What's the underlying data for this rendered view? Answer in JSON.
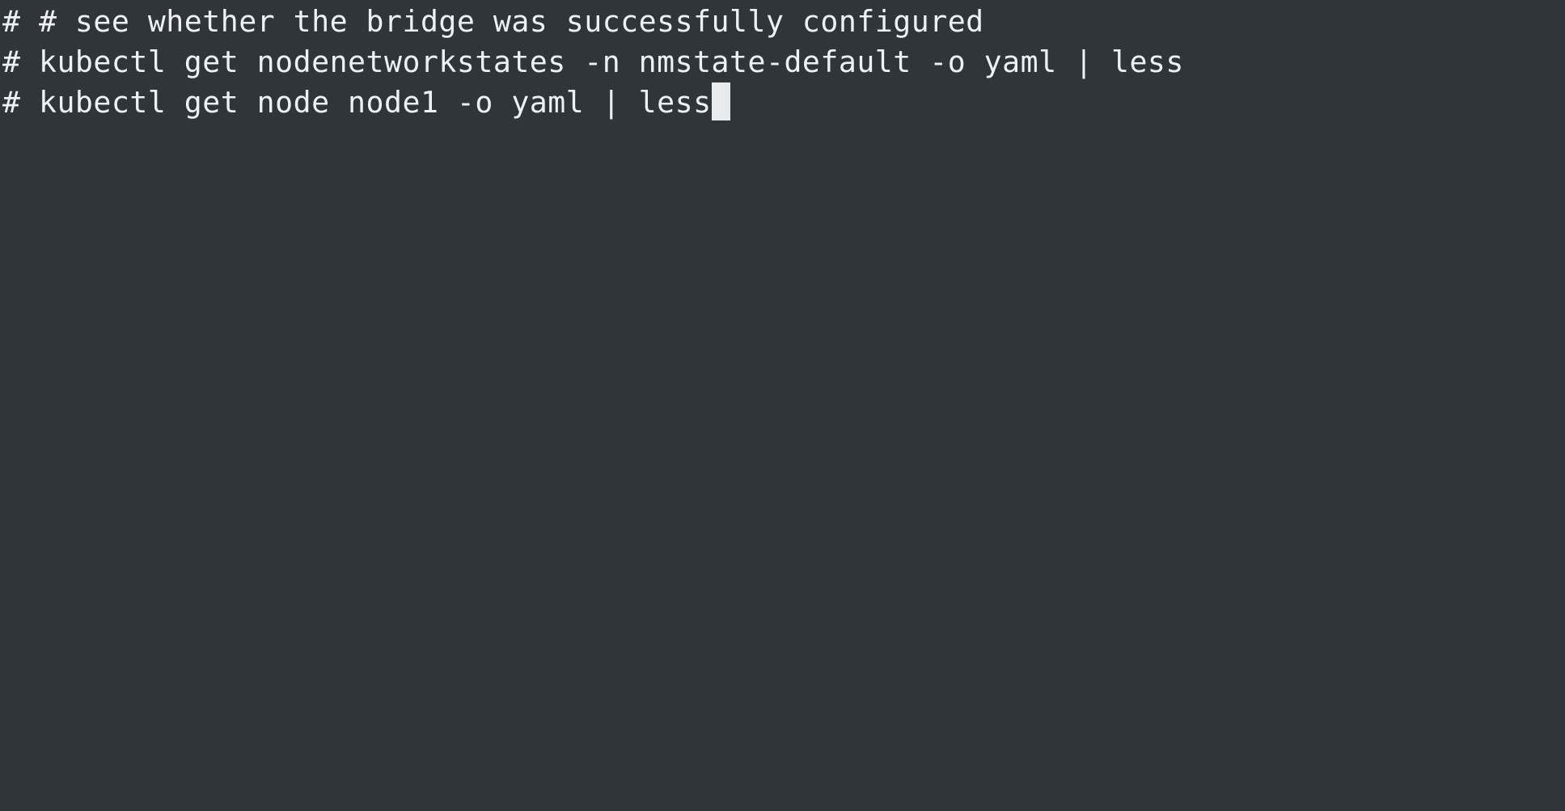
{
  "terminal": {
    "prompt": "#",
    "lines": [
      {
        "command": "# see whether the bridge was successfully configured"
      },
      {
        "command": "kubectl get nodenetworkstates -n nmstate-default -o yaml | less"
      },
      {
        "command": "kubectl get node node1 -o yaml | less"
      }
    ],
    "colors": {
      "background": "#30353a",
      "text": "#eef1f4",
      "cursor": "#e8ebee"
    }
  }
}
